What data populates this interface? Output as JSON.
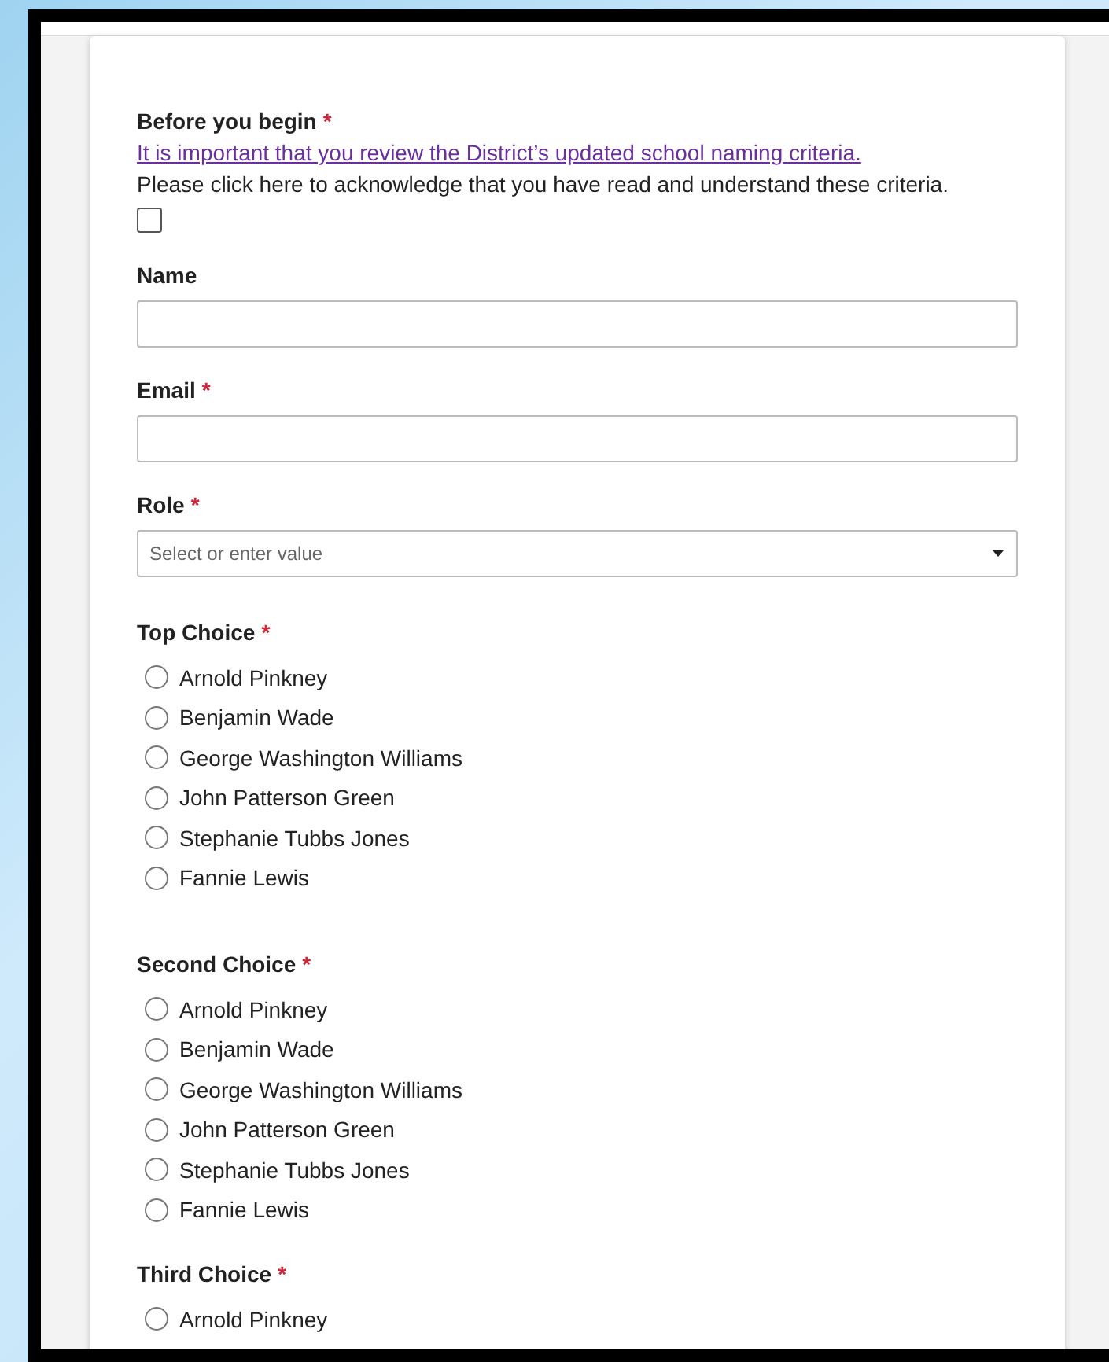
{
  "questions": [
    {
      "kind": "acknowledge",
      "label": "Before you begin",
      "required_mark": "*",
      "link": "It is important that you review the District’s updated school naming criteria.",
      "text": "Please click here to acknowledge that you have read and understand these criteria.",
      "checked": false
    },
    {
      "kind": "text",
      "label": "Name"
    },
    {
      "kind": "text",
      "label": "Email",
      "required_mark": "*"
    },
    {
      "kind": "select",
      "label": "Role",
      "required_mark": "*",
      "placeholder": "Select or enter value"
    },
    {
      "kind": "radio",
      "label": "Top Choice",
      "required_mark": "*",
      "options": [
        {
          "label": "Arnold Pinkney",
          "selected": false
        },
        {
          "label": "Benjamin Wade",
          "selected": false
        },
        {
          "label": "George Washington Williams",
          "selected": false
        },
        {
          "label": "John Patterson Green",
          "selected": false
        },
        {
          "label": "Stephanie Tubbs Jones",
          "selected": false
        },
        {
          "label": "Fannie Lewis",
          "selected": false
        }
      ]
    },
    {
      "kind": "radio",
      "label": "Second Choice",
      "required_mark": "*",
      "options": [
        {
          "label": "Arnold Pinkney",
          "selected": false
        },
        {
          "label": "Benjamin Wade",
          "selected": false
        },
        {
          "label": "George Washington Williams",
          "selected": false
        },
        {
          "label": "John Patterson Green",
          "selected": false
        },
        {
          "label": "Stephanie Tubbs Jones",
          "selected": false
        },
        {
          "label": "Fannie Lewis",
          "selected": false
        }
      ]
    },
    {
      "kind": "radio",
      "label": "Third Choice",
      "required_mark": "*",
      "options": [
        {
          "label": "Arnold Pinkney",
          "selected": false
        }
      ]
    }
  ]
}
